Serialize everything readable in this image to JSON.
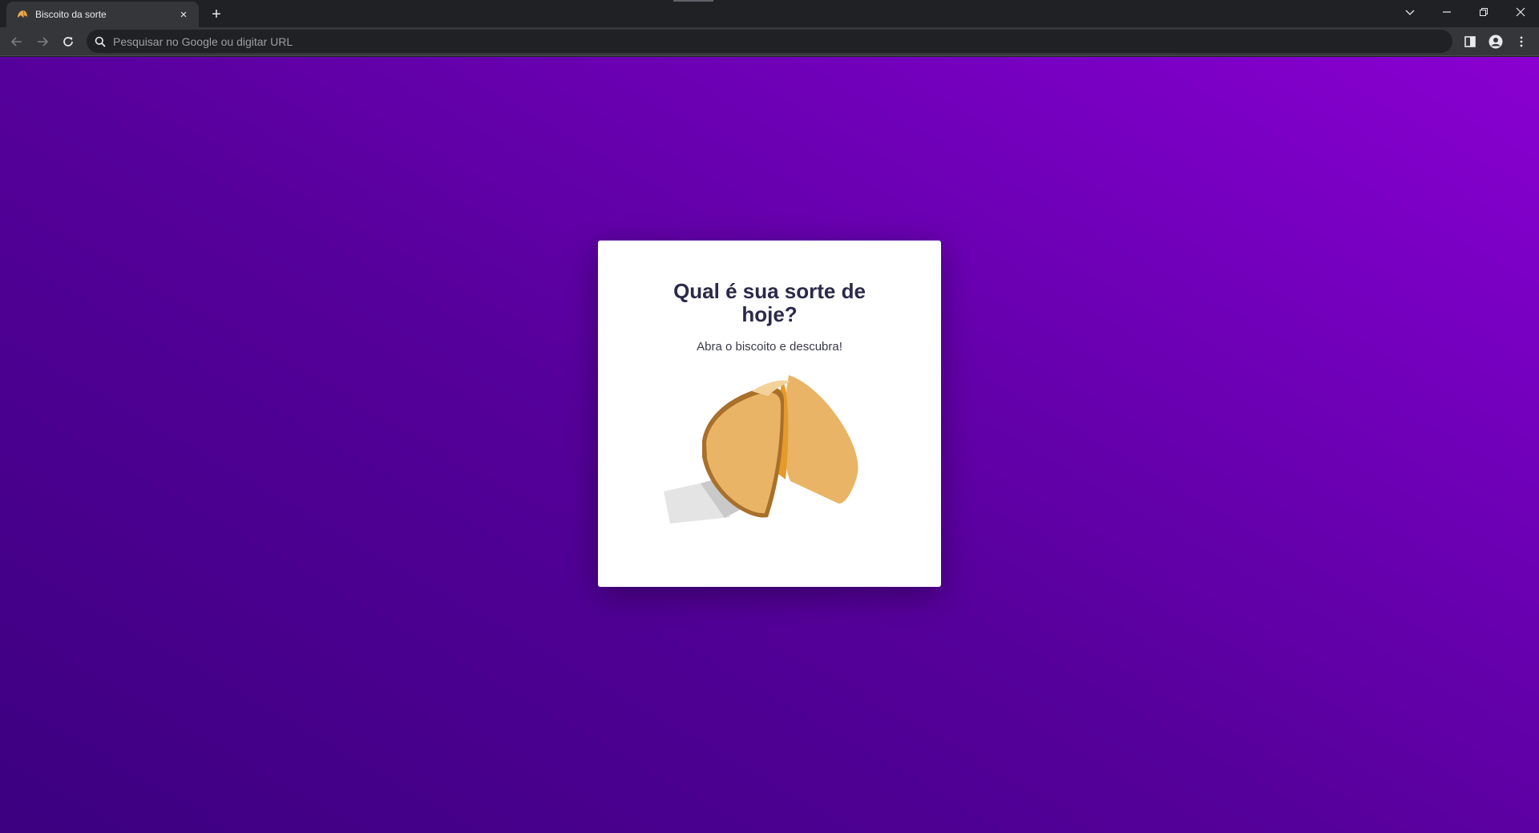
{
  "browser": {
    "tab": {
      "title": "Biscoito da sorte",
      "close_label": "×"
    },
    "new_tab_label": "+",
    "omnibox": {
      "placeholder": "Pesquisar no Google ou digitar URL",
      "value": ""
    }
  },
  "page": {
    "title": "Qual é sua sorte de hoje?",
    "subtitle": "Abra o biscoito e descubra!"
  },
  "colors": {
    "background_start": "#3c0080",
    "background_end": "#8a00d0",
    "card": "#ffffff",
    "title": "#2a2a4a",
    "cookie": "#e9b466"
  },
  "icons": {
    "favicon": "fortune-cookie-icon",
    "back": "arrow-left-icon",
    "forward": "arrow-right-icon",
    "reload": "reload-icon",
    "search": "search-icon",
    "side_panel": "side-panel-icon",
    "profile": "profile-icon",
    "menu": "kebab-menu-icon"
  }
}
